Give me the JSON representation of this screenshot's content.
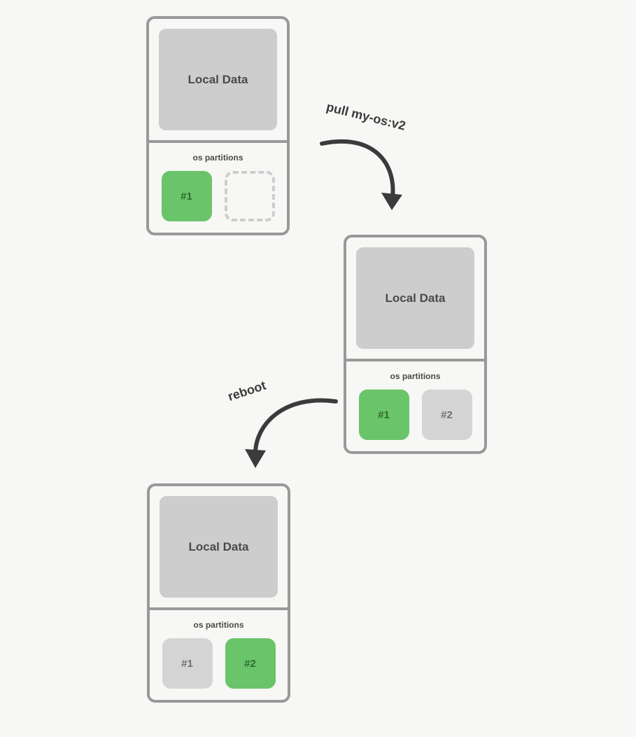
{
  "boxes": [
    {
      "local_data": "Local Data",
      "partitions_label": "os partitions",
      "p1": "#1",
      "p2": ""
    },
    {
      "local_data": "Local Data",
      "partitions_label": "os partitions",
      "p1": "#1",
      "p2": "#2"
    },
    {
      "local_data": "Local Data",
      "partitions_label": "os partitions",
      "p1": "#1",
      "p2": "#2"
    }
  ],
  "arrows": {
    "a1_label": "pull my-os:v2",
    "a2_label": "reboot"
  }
}
